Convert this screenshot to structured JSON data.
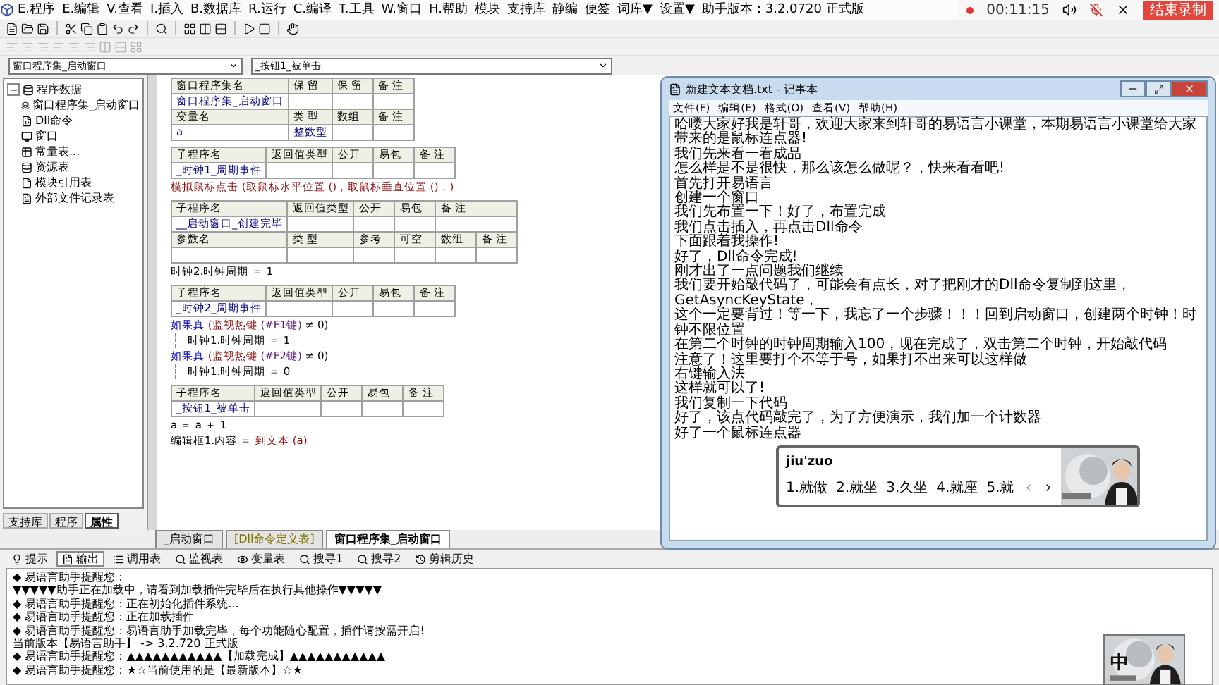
{
  "menu": [
    "E.程序",
    "E.编辑",
    "V.查看",
    "I.插入",
    "B.数据库",
    "R.运行",
    "C.编译",
    "T.工具",
    "W.窗口",
    "H.帮助",
    "模块",
    "支持库",
    "静编",
    "便签",
    "词库▼",
    "设置▼"
  ],
  "version": "助手版本：3.2.0720 正式版",
  "recorder": {
    "time": "00:11:15",
    "stop": "结束录制"
  },
  "selectors": [
    "窗口程序集_启动窗口",
    "_按钮1_被单击"
  ],
  "tree": {
    "label": "程序数据",
    "expanded": true,
    "children": [
      {
        "label": "窗口程序集_启动窗口",
        "kind": "form"
      },
      {
        "label": "Dll命令",
        "kind": "dll"
      },
      {
        "label": "窗口",
        "kind": "window"
      },
      {
        "label": "常量表...",
        "kind": "constants"
      },
      {
        "label": "资源表",
        "kind": "resources"
      },
      {
        "label": "模块引用表",
        "kind": "module"
      },
      {
        "label": "外部文件记录表",
        "kind": "file"
      }
    ]
  },
  "left_tabs": [
    {
      "label": "支持库",
      "selected": false
    },
    {
      "label": "程序",
      "selected": false
    },
    {
      "label": "属性",
      "selected": true
    }
  ],
  "blocks": [
    {
      "tables": [
        {
          "kind": "header",
          "cells": [
            "窗口程序集名",
            "保 留",
            "保 留",
            "备 注"
          ]
        },
        {
          "kind": "value",
          "cells": [
            "窗口程序集_启动窗口"
          ]
        },
        {
          "kind": "header",
          "cells": [
            "变量名",
            "类 型",
            "数组",
            "备 注"
          ]
        },
        {
          "kind": "value",
          "cells": [
            "a",
            "整数型"
          ]
        }
      ]
    },
    {
      "tables": [
        {
          "kind": "header",
          "cells": [
            "子程序名",
            "返回值类型",
            "公开",
            "易包",
            "备 注"
          ]
        },
        {
          "kind": "value",
          "cells": [
            "_时钟1_周期事件"
          ]
        }
      ],
      "lines": [
        {
          "parts": [
            {
              "text": "模拟鼠标点击 (取鼠标水平位置 ()，取鼠标垂直位置 ()，)",
              "kind": "cmd"
            }
          ]
        }
      ]
    },
    {
      "tables": [
        {
          "kind": "header",
          "cells": [
            "子程序名",
            "返回值类型",
            "公开",
            "易包",
            "备 注"
          ]
        },
        {
          "kind": "value",
          "cells": [
            "__启动窗口_创建完毕"
          ]
        },
        {
          "kind": "header",
          "cells": [
            "参数名",
            "类 型",
            "参考",
            "可空",
            "数组",
            "备 注"
          ]
        },
        {
          "kind": "value"
        }
      ],
      "lines": [
        {
          "parts": [
            {
              "text": "时钟2.时钟周期 ＝ 1",
              "kind": "plain"
            }
          ]
        }
      ]
    },
    {
      "tables": [
        {
          "kind": "header",
          "cells": [
            "子程序名",
            "返回值类型",
            "公开",
            "易包",
            "备 注"
          ]
        },
        {
          "kind": "value",
          "cells": [
            "_时钟2_周期事件"
          ]
        }
      ],
      "lines": [
        {
          "parts": [
            {
              "text": "如果真",
              "kind": "flow"
            },
            {
              "text": " (监视热键",
              "kind": "cmd"
            },
            {
              "text": " (#F1键)",
              "kind": "const"
            },
            {
              "text": " ≠ 0)",
              "kind": "plain"
            }
          ],
          "children": [
            {
              "parts": [
                {
                  "text": "时钟1.时钟周期 ＝ 1",
                  "kind": "plain"
                }
              ]
            }
          ]
        },
        {
          "parts": [
            {
              "text": "如果真",
              "kind": "flow"
            },
            {
              "text": " (监视热键",
              "kind": "cmd"
            },
            {
              "text": " (#F2键)",
              "kind": "const"
            },
            {
              "text": " ≠ 0)",
              "kind": "plain"
            }
          ],
          "children": [
            {
              "parts": [
                {
                  "text": "时钟1.时钟周期 ＝ 0",
                  "kind": "plain"
                }
              ]
            }
          ]
        }
      ]
    },
    {
      "tables": [
        {
          "kind": "header",
          "cells": [
            "子程序名",
            "返回值类型",
            "公开",
            "易包",
            "备 注"
          ]
        },
        {
          "kind": "value",
          "cells": [
            "_按钮1_被单击"
          ]
        }
      ],
      "lines": [
        {
          "parts": [
            {
              "text": "a ＝ a ＋ 1",
              "kind": "plain"
            }
          ]
        },
        {
          "parts": [
            {
              "text": "编辑框1.内容 ＝ ",
              "kind": "plain"
            },
            {
              "text": "到文本 (a)",
              "kind": "cmd"
            }
          ]
        }
      ]
    }
  ],
  "editor_tabs": [
    {
      "label": "_启动窗口",
      "selected": false
    },
    {
      "label": "[Dll命令定义表]",
      "selected": false
    },
    {
      "label": "窗口程序集_启动窗口",
      "selected": true
    }
  ],
  "output_tabs": [
    {
      "label": "提示",
      "selected": false
    },
    {
      "label": "输出",
      "selected": true
    },
    {
      "label": "调用表",
      "selected": false
    },
    {
      "label": "监视表",
      "selected": false
    },
    {
      "label": "变量表",
      "selected": false
    },
    {
      "label": "搜寻1",
      "selected": false
    },
    {
      "label": "搜寻2",
      "selected": false
    },
    {
      "label": "剪辑历史",
      "selected": false
    }
  ],
  "output": [
    "◆ 易语言助手提醒您：",
    "▼▼▼▼▼助手正在加载中，请看到加载插件完毕后在执行其他操作▼▼▼▼▼",
    "◆ 易语言助手提醒您：正在初始化插件系统...",
    "◆ 易语言助手提醒您：正在加载插件",
    "◆ 易语言助手提醒您：易语言助手加载完毕，每个功能随心配置，插件请按需开启!",
    "当前版本【易语言助手】 -> 3.2.720 正式版",
    "◆ 易语言助手提醒您：▲▲▲▲▲▲▲▲▲▲▲【加载完成】▲▲▲▲▲▲▲▲▲▲▲",
    "◆ 易语言助手提醒您：★☆当前使用的是【最新版本】☆★"
  ],
  "ime_status": "中",
  "notepad": {
    "title": "新建文本文档.txt - 记事本",
    "menu": [
      "文件(F)",
      "编辑(E)",
      "格式(O)",
      "查看(V)",
      "帮助(H)"
    ],
    "lines": [
      "哈喽大家好我是轩哥，欢迎大家来到轩哥的易语言小课堂，本期易语言小课堂给大家带来的是鼠标连点器!",
      "我们先来看一看成品",
      "怎么样是不是很快，那么该怎么做呢？，快来看看吧!",
      "首先打开易语言",
      "创建一个窗口",
      "我们先布置一下！好了，布置完成",
      "我们点击插入，再点击Dll命令",
      "下面跟着我操作!",
      "好了，Dll命令完成!",
      "刚才出了一点问题我们继续",
      "我们要开始敲代码了，可能会有点长，对了把刚才的Dll命令复制到这里，GetAsyncKeyState，",
      "这个一定要背过！等一下，我忘了一个步骤！！！回到启动窗口，创建两个时钟！时钟不限位置",
      "在第二个时钟的时钟周期输入100，现在完成了，双击第二个时钟，开始敲代码",
      "注意了！这里要打个不等于号，如果打不出来可以这样做",
      "右键输入法",
      "这样就可以了!",
      "我们复制一下代码",
      "好了，该点代码敲完了，为了方便演示，我们加一个计数器",
      "好了一个鼠标连点器"
    ]
  },
  "ime": {
    "composition": "jiu'zuo",
    "candidates": [
      "1.就做",
      "2.就坐",
      "3.久坐",
      "4.就座",
      "5.就"
    ]
  }
}
